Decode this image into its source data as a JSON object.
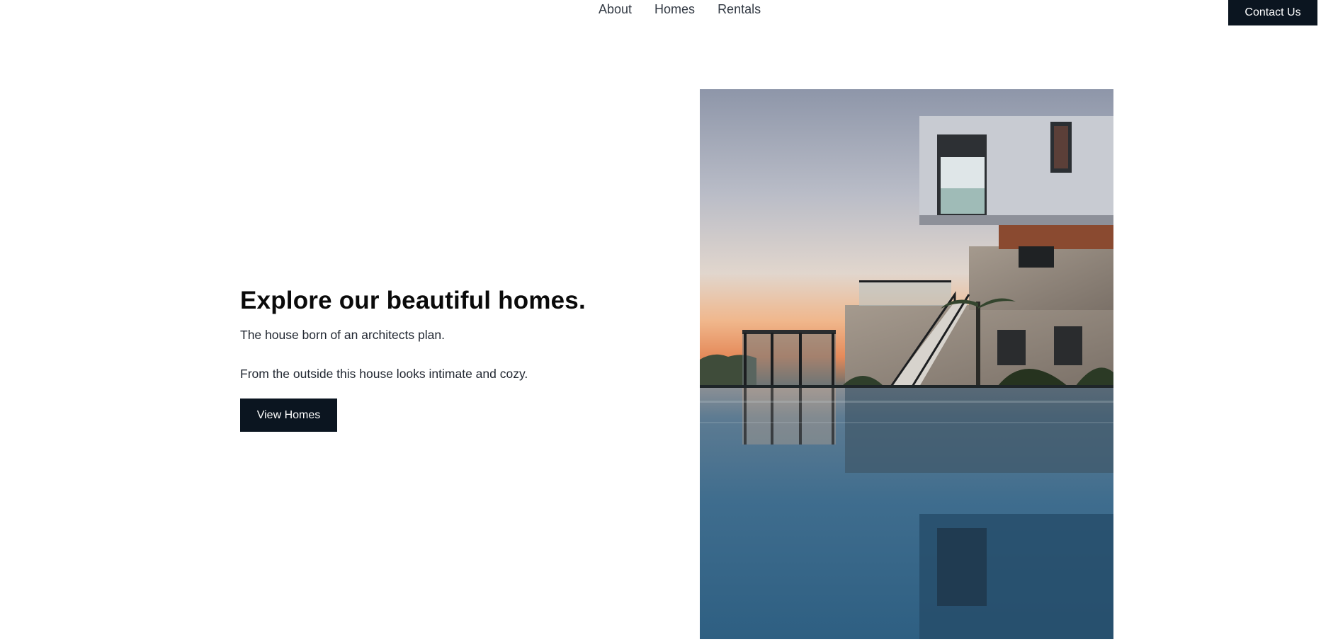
{
  "nav": {
    "links": [
      "About",
      "Homes",
      "Rentals"
    ],
    "contact_label": "Contact Us"
  },
  "hero": {
    "title": "Explore our beautiful homes.",
    "paragraph_1": "The house born of an architects plan.",
    "paragraph_2": "From the outside this house looks intimate and cozy.",
    "button_label": "View Homes",
    "image_subject": "modern-house-with-pool-at-dusk"
  },
  "colors": {
    "button_bg": "#0b1520",
    "button_text": "#ffffff",
    "nav_text": "#333a44",
    "title_text": "#0a0a0a"
  }
}
